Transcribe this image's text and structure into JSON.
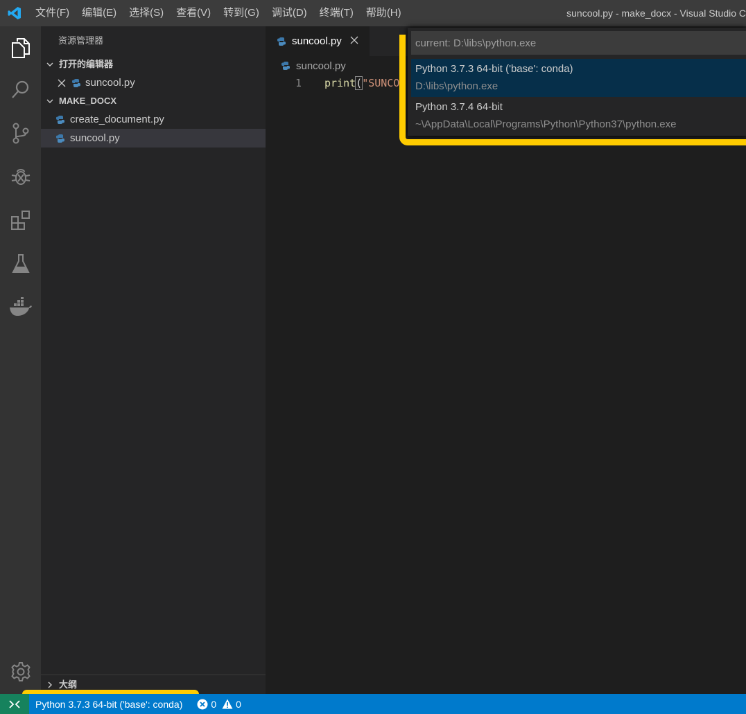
{
  "titlebar": {
    "menu": [
      "文件(F)",
      "编辑(E)",
      "选择(S)",
      "查看(V)",
      "转到(G)",
      "调试(D)",
      "终端(T)",
      "帮助(H)"
    ],
    "window_title": "suncool.py - make_docx - Visual Studio C"
  },
  "activitybar": {
    "icons": [
      "explorer-icon",
      "search-icon",
      "source-control-icon",
      "debug-icon",
      "extensions-icon",
      "test-flask-icon",
      "docker-icon",
      "settings-gear-icon"
    ]
  },
  "sidebar": {
    "title": "资源管理器",
    "open_editors_label": "打开的编辑器",
    "open_editors": [
      {
        "name": "suncool.py"
      }
    ],
    "folder_label": "MAKE_DOCX",
    "files": [
      {
        "name": "create_document.py"
      },
      {
        "name": "suncool.py"
      }
    ],
    "outline_label": "大纲"
  },
  "editor": {
    "tab_label": "suncool.py",
    "breadcrumb": "suncool.py",
    "line_number": "1",
    "code_fn": "print",
    "code_paren": "(",
    "code_str": "\"SUNCO"
  },
  "quickpick": {
    "placeholder": "current: D:\\libs\\python.exe",
    "items": [
      {
        "label": "Python 3.7.3 64-bit ('base': conda)",
        "detail": "D:\\libs\\python.exe"
      },
      {
        "label": "Python 3.7.4 64-bit",
        "detail": "~\\AppData\\Local\\Programs\\Python\\Python37\\python.exe"
      }
    ]
  },
  "statusbar": {
    "interpreter": "Python 3.7.3 64-bit ('base': conda)",
    "errors": "0",
    "warnings": "0"
  },
  "colors": {
    "accent_blue": "#007acc",
    "highlight_yellow": "#ffcc00",
    "remote_green": "#16825d"
  }
}
